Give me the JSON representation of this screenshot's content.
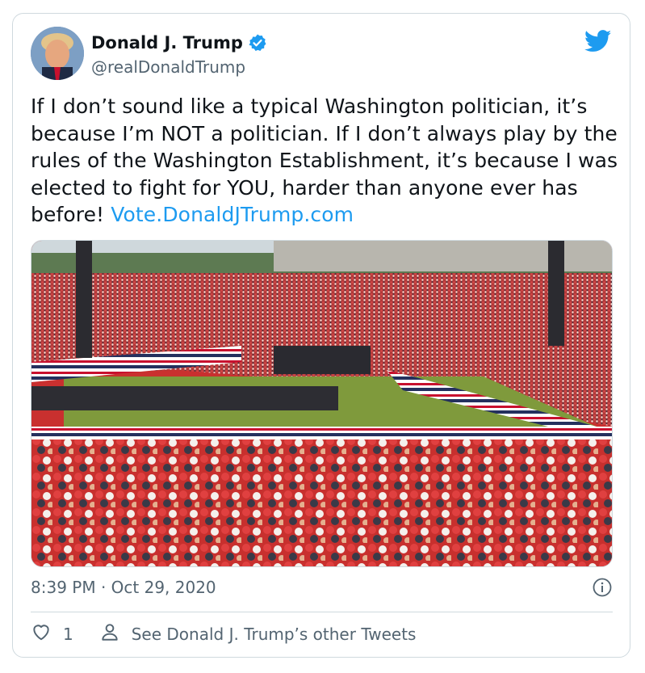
{
  "tweet": {
    "author_name": "Donald J. Trump",
    "handle": "@realDonaldTrump",
    "body_text": "If I don’t sound like a typical Washington politician, it’s because I’m NOT a politician. If I don’t always play by the rules of the Washington Establishment, it’s because I was elected to fight for YOU, harder than anyone ever has before! ",
    "link_text": "Vote.DonaldJTrump.com",
    "timestamp": "8:39 PM · Oct 29, 2020",
    "like_count": "1",
    "see_more_label": "See Donald J. Trump’s other Tweets"
  },
  "icons": {
    "verified": "verified-badge-icon",
    "brand": "twitter-bird-icon",
    "info": "info-icon",
    "like": "heart-icon",
    "profile": "person-icon"
  },
  "colors": {
    "accent": "#1d9bf0",
    "text": "#0f1419",
    "secondary": "#536471",
    "border": "#cfd9de"
  }
}
